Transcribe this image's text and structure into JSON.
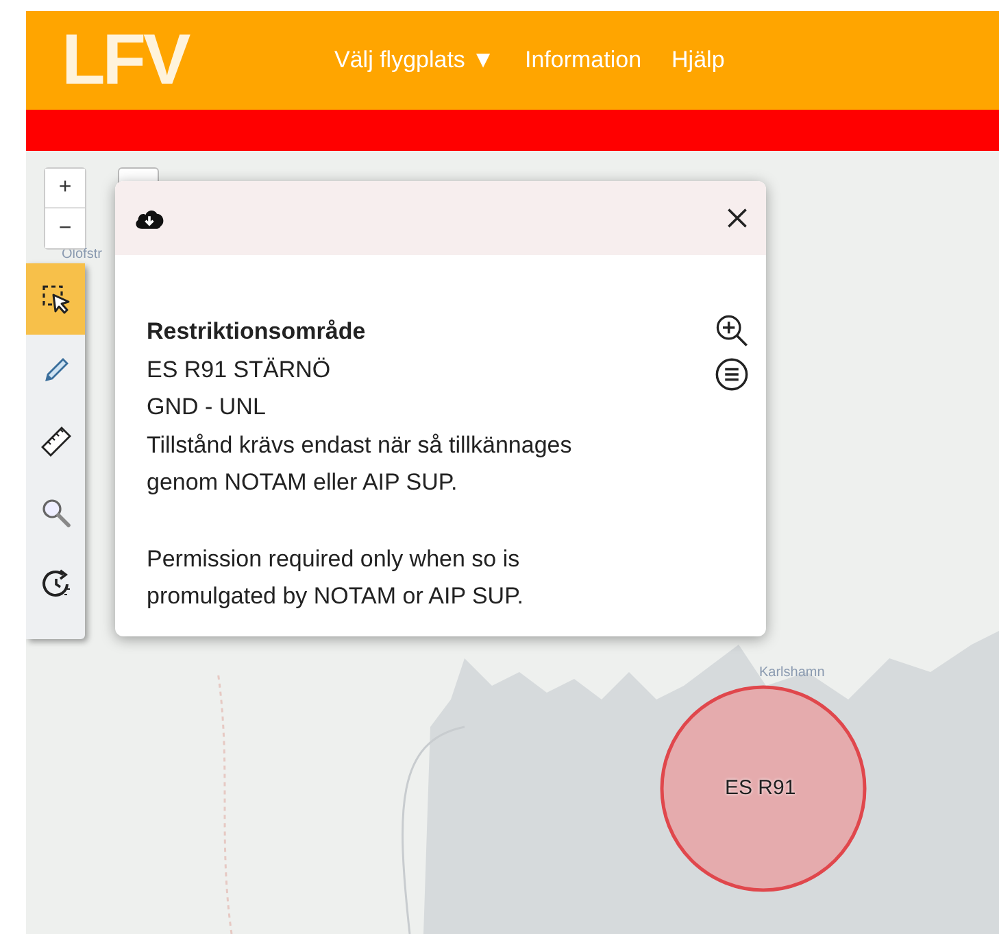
{
  "header": {
    "logo": "LFV",
    "nav": [
      {
        "label": "Välj flygplats",
        "caret": "▼"
      },
      {
        "label": "Information"
      },
      {
        "label": "Hjälp"
      }
    ]
  },
  "zoom_control": {
    "buttons": [
      "+",
      "−"
    ]
  },
  "tools": [
    {
      "kind": "select",
      "selected": true
    },
    {
      "kind": "pencil",
      "selected": false
    },
    {
      "kind": "ruler",
      "selected": false
    },
    {
      "kind": "search",
      "selected": false
    },
    {
      "kind": "timer",
      "selected": false
    }
  ],
  "popup": {
    "title": "Restriktionsområde",
    "lines": [
      "ES R91 STÄRNÖ",
      "GND - UNL"
    ],
    "paragraphs": [
      "Tillstånd krävs endast när så tillkännages genom NOTAM eller AIP SUP.",
      "Permission required only when so is promulgated by NOTAM or AIP SUP."
    ]
  },
  "map": {
    "places": [
      "Olofstr",
      "Karlshamn"
    ],
    "area_label": "ES R91"
  }
}
